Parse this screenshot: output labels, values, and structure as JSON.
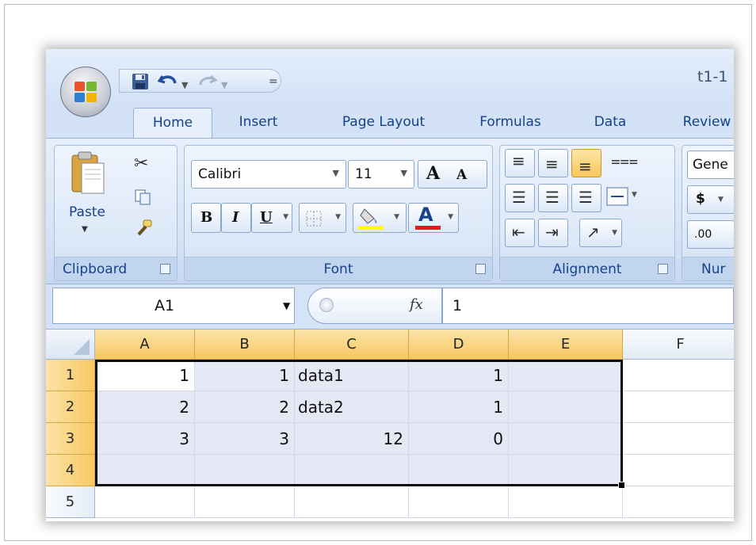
{
  "window": {
    "title": "t1-1"
  },
  "qat": {
    "icons": [
      "save-icon",
      "undo-icon",
      "redo-icon",
      "customize-icon"
    ]
  },
  "tabs": [
    {
      "label": "Home",
      "active": true
    },
    {
      "label": "Insert"
    },
    {
      "label": "Page Layout"
    },
    {
      "label": "Formulas"
    },
    {
      "label": "Data"
    },
    {
      "label": "Review"
    }
  ],
  "ribbon": {
    "clipboard": {
      "label": "Clipboard",
      "paste_label": "Paste"
    },
    "font": {
      "label": "Font",
      "font_name": "Calibri",
      "font_size": "11",
      "bold": "B",
      "italic": "I",
      "underline": "U",
      "grow": "A",
      "shrink": "A",
      "font_color_letter": "A",
      "highlight_color": "#ffff00",
      "font_color": "#e11b1b"
    },
    "alignment": {
      "label": "Alignment"
    },
    "number": {
      "label": "Nur",
      "format": "Gene",
      "currency": "$",
      "decimal": ".00"
    }
  },
  "formula_bar": {
    "name_box": "A1",
    "fx": "fx",
    "content": "1"
  },
  "sheet": {
    "columns": [
      "A",
      "B",
      "C",
      "D",
      "E",
      "F"
    ],
    "rows": [
      "1",
      "2",
      "3",
      "4",
      "5"
    ],
    "cells": [
      [
        "1",
        "1",
        "data1",
        "1",
        "",
        ""
      ],
      [
        "2",
        "2",
        "data2",
        "1",
        "",
        ""
      ],
      [
        "3",
        "3",
        "12",
        "0",
        "",
        ""
      ],
      [
        "",
        "",
        "",
        "",
        "",
        ""
      ],
      [
        "",
        "",
        "",
        "",
        "",
        ""
      ]
    ],
    "selection": "A1:E4",
    "active_cell": "A1"
  },
  "colors": {
    "ribbon_blue": "#c9daf1",
    "selected_header": "#f8c862",
    "selection_fill": "#e5e8f4"
  }
}
